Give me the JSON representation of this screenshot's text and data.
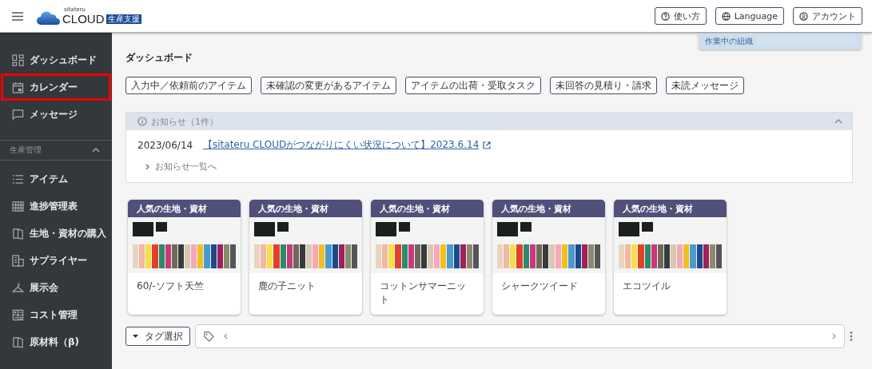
{
  "header": {
    "logo": {
      "small": "sitateru",
      "main": "CLOUD",
      "badge": "生産支援"
    },
    "buttons": [
      {
        "kind": "help",
        "label": "使い方"
      },
      {
        "kind": "language",
        "label": "Language"
      },
      {
        "kind": "account",
        "label": "アカウント"
      }
    ],
    "org_panel": {
      "label": "作業中の組織"
    }
  },
  "sidebar": {
    "items": [
      {
        "label": "ダッシュボード",
        "highlighted": false
      },
      {
        "label": "カレンダー",
        "highlighted": true
      },
      {
        "label": "メッセージ",
        "highlighted": false
      }
    ],
    "section": {
      "title": "生産管理",
      "expanded": true,
      "items": [
        {
          "label": "アイテム",
          "highlighted": false
        },
        {
          "label": "進捗管理表",
          "highlighted": false
        },
        {
          "label": "生地・資材の購入",
          "highlighted": false
        },
        {
          "label": "サプライヤー",
          "highlighted": false
        },
        {
          "label": "展示会",
          "highlighted": false
        },
        {
          "label": "コスト管理",
          "highlighted": false
        },
        {
          "label": "原材料（β)",
          "highlighted": false
        }
      ]
    }
  },
  "page_title": "ダッシュボード",
  "filters": [
    "入力中／依頼前のアイテム",
    "未確認の変更があるアイテム",
    "アイテムの出荷・受取タスク",
    "未回答の見積り・請求",
    "未読メッセージ"
  ],
  "notices": {
    "title": "お知らせ（1件）",
    "expanded": true,
    "items": [
      {
        "date": "2023/06/14",
        "text": "【sitateru CLOUDがつながりにくい状況について】2023.6.14"
      }
    ],
    "more": "お知らせ一覧へ"
  },
  "cards": [
    {
      "header": "人気の生地・資材",
      "name": "60/-ソフト天竺"
    },
    {
      "header": "人気の生地・資材",
      "name": "鹿の子ニット"
    },
    {
      "header": "人気の生地・資材",
      "name": "コットンサマーニット"
    },
    {
      "header": "人気の生地・資材",
      "name": "シャークツイード"
    },
    {
      "header": "人気の生地・資材",
      "name": "エコツイル"
    }
  ],
  "tag_bar": {
    "button": "タグ選択"
  }
}
